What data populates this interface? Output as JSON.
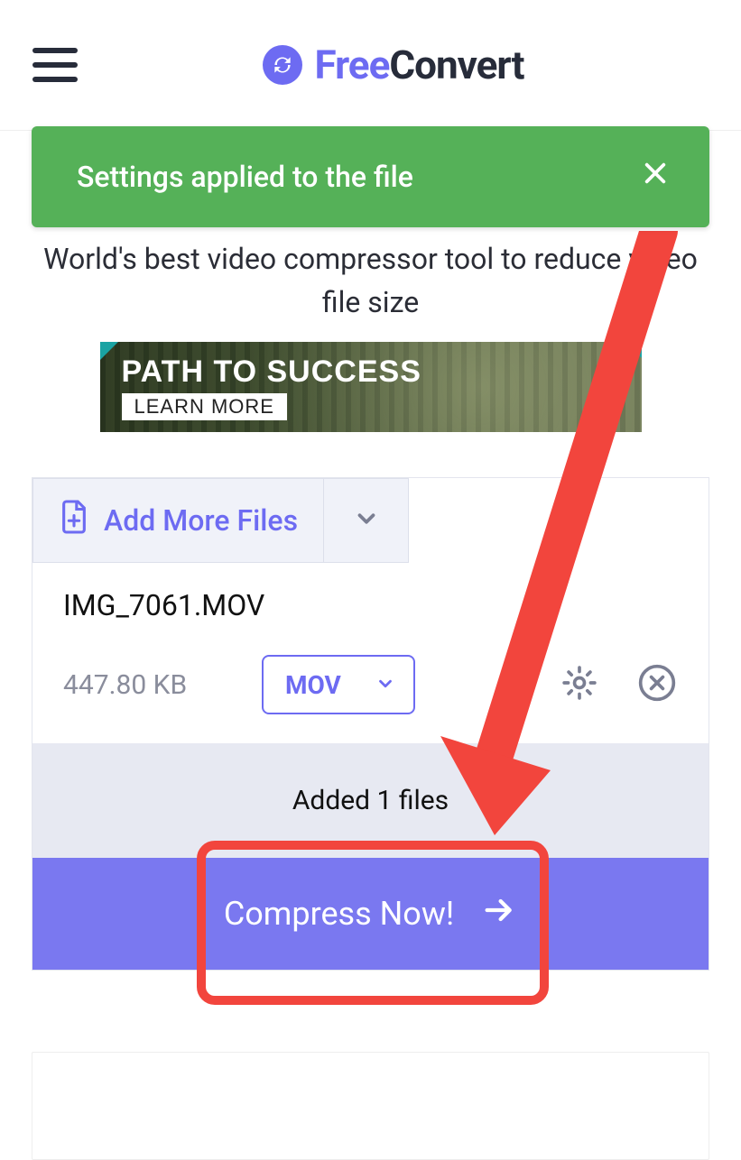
{
  "header": {
    "brand_free": "Free",
    "brand_convert": "Convert"
  },
  "toast": {
    "message": "Settings applied to the file"
  },
  "subtitle": "World's best video compressor tool to reduce video file size",
  "ad": {
    "title": "PATH TO SUCCESS",
    "cta": "LEARN MORE"
  },
  "uploader": {
    "add_label": "Add More Files"
  },
  "file": {
    "name": "IMG_7061.MOV",
    "size": "447.80 KB",
    "format": "MOV"
  },
  "status": {
    "added_text": "Added 1 files"
  },
  "action": {
    "compress_label": "Compress Now!"
  }
}
